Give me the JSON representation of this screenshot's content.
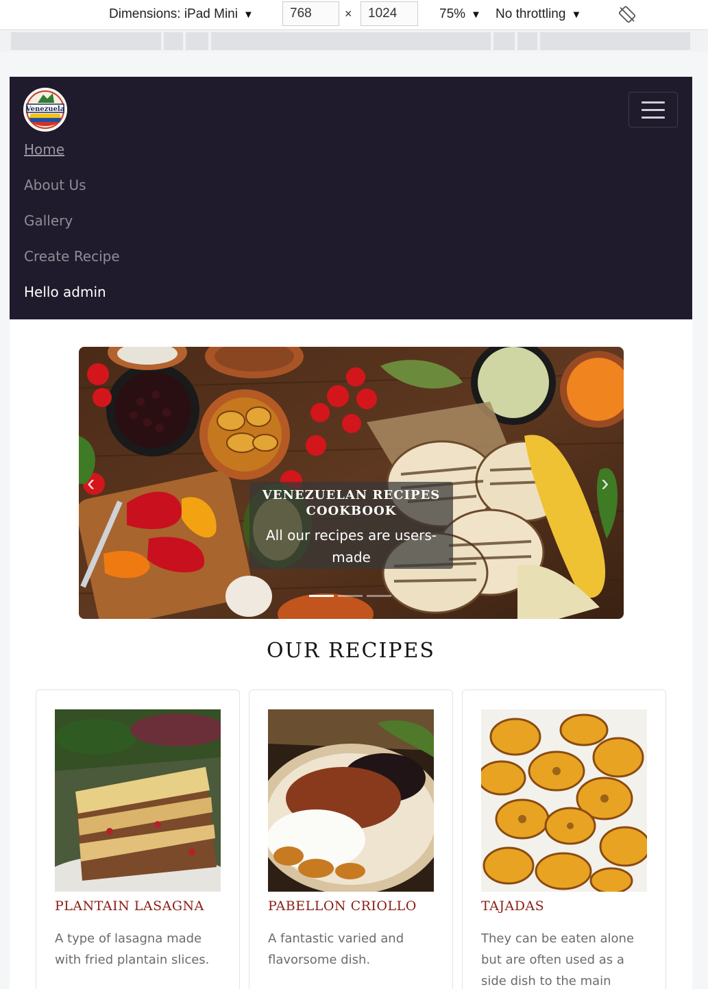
{
  "devtools": {
    "dimensions_label": "Dimensions: iPad Mini",
    "width_value": "768",
    "times": "×",
    "height_value": "1024",
    "zoom": "75%",
    "throttling": "No throttling",
    "caret": "▼"
  },
  "nav": {
    "logo_text": "Venezuela",
    "links": [
      {
        "label": "Home"
      },
      {
        "label": "About Us"
      },
      {
        "label": "Gallery"
      },
      {
        "label": "Create Recipe"
      },
      {
        "label": "Hello admin"
      }
    ]
  },
  "hero": {
    "title_line1": "VENEZUELAN RECIPES",
    "title_line2": "COOKBOOK",
    "subtitle_line1": "All our recipes are users-",
    "subtitle_line2": "made",
    "prev_glyph": "‹",
    "next_glyph": "›"
  },
  "section_title": "OUR RECIPES",
  "recipes": [
    {
      "title": "PLANTAIN LASAGNA",
      "desc": "A type of lasagna made with fried plantain slices."
    },
    {
      "title": "PABELLON CRIOLLO",
      "desc": "A fantastic varied and flavorsome dish."
    },
    {
      "title": "TAJADAS",
      "desc": "They can be eaten alone but are often used as a side dish to the main"
    }
  ],
  "colors": {
    "navbar_bg": "#1f1b2c",
    "card_title": "#8b1d14"
  }
}
